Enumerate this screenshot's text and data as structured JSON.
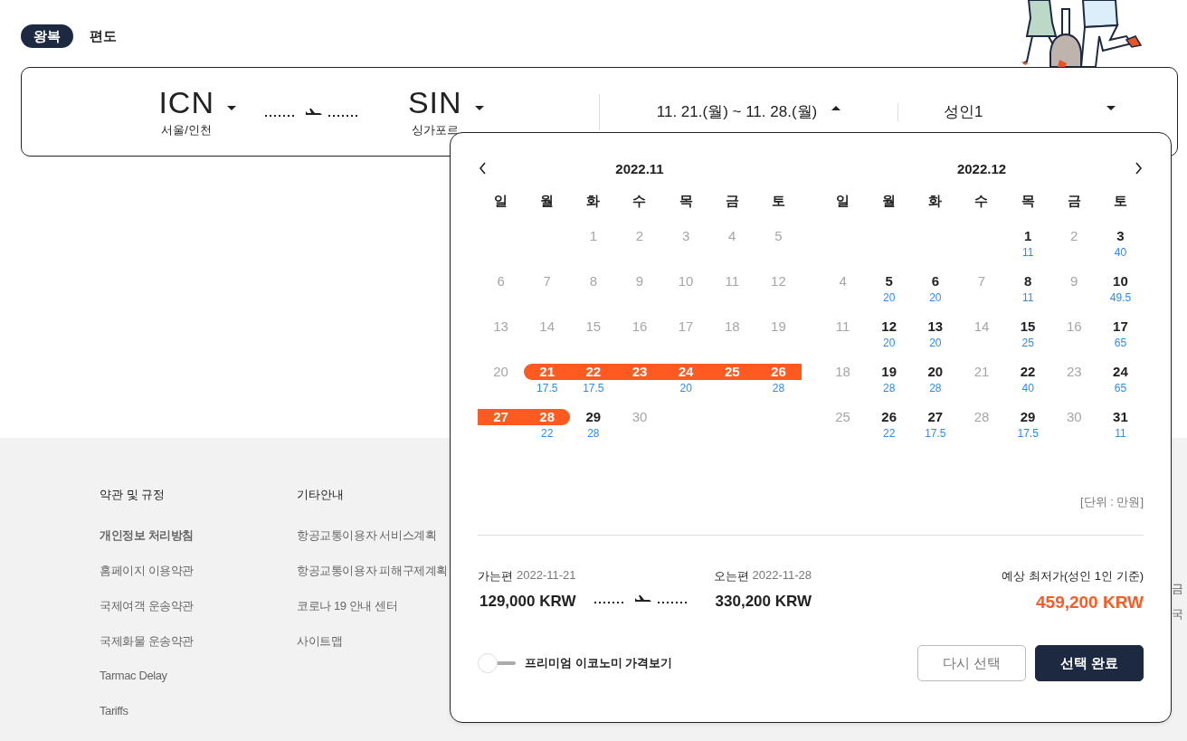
{
  "trip_tabs": [
    {
      "label": "왕복",
      "selected": true
    },
    {
      "label": "편도",
      "selected": false
    }
  ],
  "search": {
    "origin": {
      "code": "ICN",
      "city": "서울/인천"
    },
    "destination": {
      "code": "SIN",
      "city": "싱가포르"
    },
    "dates": {
      "text": "11. 21.(월) ~ 11. 28.(월)",
      "expanded": true
    },
    "passengers": {
      "text": "성인1",
      "expanded": false
    }
  },
  "calendar": {
    "months": [
      {
        "title": "2022.11",
        "weekdays": [
          "일",
          "월",
          "화",
          "수",
          "목",
          "금",
          "토"
        ],
        "weeks": [
          [
            {
              "kind": "blank"
            },
            {
              "kind": "blank"
            },
            {
              "kind": "off",
              "day": "1"
            },
            {
              "kind": "off",
              "day": "2"
            },
            {
              "kind": "off",
              "day": "3"
            },
            {
              "kind": "off",
              "day": "4"
            },
            {
              "kind": "off",
              "day": "5"
            }
          ],
          [
            {
              "kind": "off",
              "day": "6"
            },
            {
              "kind": "off",
              "day": "7"
            },
            {
              "kind": "off",
              "day": "8"
            },
            {
              "kind": "off",
              "day": "9"
            },
            {
              "kind": "off",
              "day": "10"
            },
            {
              "kind": "off",
              "day": "11"
            },
            {
              "kind": "off",
              "day": "12"
            }
          ],
          [
            {
              "kind": "off",
              "day": "13"
            },
            {
              "kind": "off",
              "day": "14"
            },
            {
              "kind": "off",
              "day": "15"
            },
            {
              "kind": "off",
              "day": "16"
            },
            {
              "kind": "off",
              "day": "17"
            },
            {
              "kind": "off",
              "day": "18"
            },
            {
              "kind": "off",
              "day": "19"
            }
          ],
          [
            {
              "kind": "off",
              "day": "20"
            },
            {
              "kind": "start",
              "day": "21",
              "price": "17.5"
            },
            {
              "kind": "mid",
              "day": "22",
              "price": "17.5"
            },
            {
              "kind": "mid",
              "day": "23"
            },
            {
              "kind": "mid",
              "day": "24",
              "price": "20"
            },
            {
              "kind": "mid",
              "day": "25"
            },
            {
              "kind": "mid",
              "day": "26",
              "price": "28"
            }
          ],
          [
            {
              "kind": "mid",
              "day": "27"
            },
            {
              "kind": "end",
              "day": "28",
              "price": "22"
            },
            {
              "kind": "open",
              "day": "29",
              "price": "28"
            },
            {
              "kind": "off",
              "day": "30"
            }
          ]
        ]
      },
      {
        "title": "2022.12",
        "weekdays": [
          "일",
          "월",
          "화",
          "수",
          "목",
          "금",
          "토"
        ],
        "weeks": [
          [
            {
              "kind": "blank"
            },
            {
              "kind": "blank"
            },
            {
              "kind": "blank"
            },
            {
              "kind": "blank"
            },
            {
              "kind": "open",
              "day": "1",
              "price": "11"
            },
            {
              "kind": "off",
              "day": "2"
            },
            {
              "kind": "open",
              "day": "3",
              "price": "40"
            }
          ],
          [
            {
              "kind": "off",
              "day": "4"
            },
            {
              "kind": "open",
              "day": "5",
              "price": "20"
            },
            {
              "kind": "open",
              "day": "6",
              "price": "20"
            },
            {
              "kind": "off",
              "day": "7"
            },
            {
              "kind": "open",
              "day": "8",
              "price": "11"
            },
            {
              "kind": "off",
              "day": "9"
            },
            {
              "kind": "open",
              "day": "10",
              "price": "49.5"
            }
          ],
          [
            {
              "kind": "off",
              "day": "11"
            },
            {
              "kind": "open",
              "day": "12",
              "price": "20"
            },
            {
              "kind": "open",
              "day": "13",
              "price": "20"
            },
            {
              "kind": "off",
              "day": "14"
            },
            {
              "kind": "open",
              "day": "15",
              "price": "25"
            },
            {
              "kind": "off",
              "day": "16"
            },
            {
              "kind": "open",
              "day": "17",
              "price": "65"
            }
          ],
          [
            {
              "kind": "off",
              "day": "18"
            },
            {
              "kind": "open",
              "day": "19",
              "price": "28"
            },
            {
              "kind": "open",
              "day": "20",
              "price": "28"
            },
            {
              "kind": "off",
              "day": "21"
            },
            {
              "kind": "open",
              "day": "22",
              "price": "40"
            },
            {
              "kind": "off",
              "day": "23"
            },
            {
              "kind": "open",
              "day": "24",
              "price": "65"
            }
          ],
          [
            {
              "kind": "off",
              "day": "25"
            },
            {
              "kind": "open",
              "day": "26",
              "price": "22"
            },
            {
              "kind": "open",
              "day": "27",
              "price": "17.5"
            },
            {
              "kind": "off",
              "day": "28"
            },
            {
              "kind": "open",
              "day": "29",
              "price": "17.5"
            },
            {
              "kind": "off",
              "day": "30"
            },
            {
              "kind": "open",
              "day": "31",
              "price": "11"
            }
          ]
        ]
      }
    ],
    "unit_note": "[단위 : 만원]",
    "outbound": {
      "label": "가는편",
      "date": "2022-11-21",
      "price": "129,000 KRW"
    },
    "inbound": {
      "label": "오는편",
      "date": "2022-11-28",
      "price": "330,200 KRW"
    },
    "total": {
      "label": "예상 최저가(성인 1인 기준)",
      "price": "459,200 KRW"
    },
    "premium_toggle": {
      "label": "프리미엄 이코노미 가격보기",
      "on": false
    },
    "buttons": [
      {
        "label": "다시 선택",
        "kind": "secondary"
      },
      {
        "label": "선택 완료",
        "kind": "primary"
      }
    ]
  },
  "footer": {
    "columns": [
      {
        "title": "약관 및 규정",
        "links": [
          {
            "label": "개인정보 처리방침",
            "bold": true
          },
          {
            "label": "홈페이지 이용약관",
            "bold": false
          },
          {
            "label": "국제여객 운송약관",
            "bold": false
          },
          {
            "label": "국제화물 운송약관",
            "bold": false
          },
          {
            "label": "Tarmac Delay",
            "bold": false
          },
          {
            "label": "Tariffs",
            "bold": false
          }
        ]
      },
      {
        "title": "기타안내",
        "links": [
          {
            "label": "항공교통이용자 서비스계획",
            "bold": false
          },
          {
            "label": "항공교통이용자 피해구제계획",
            "bold": false
          },
          {
            "label": "코로나 19 안내 센터",
            "bold": false
          },
          {
            "label": "사이트맵",
            "bold": false
          }
        ]
      }
    ],
    "edge_texts": [
      "금",
      "국"
    ]
  }
}
